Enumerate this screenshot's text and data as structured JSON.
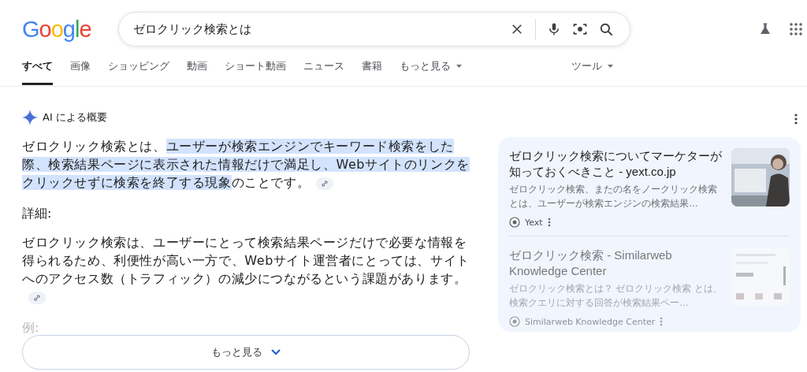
{
  "logo": "Google",
  "search": {
    "value": "ゼロクリック検索とは"
  },
  "tabs": [
    {
      "label": "すべて",
      "selected": true,
      "kind": "tab"
    },
    {
      "label": "画像",
      "selected": false,
      "kind": "tab"
    },
    {
      "label": "ショッピング",
      "selected": false,
      "kind": "tab"
    },
    {
      "label": "動画",
      "selected": false,
      "kind": "tab"
    },
    {
      "label": "ショート動画",
      "selected": false,
      "kind": "tab"
    },
    {
      "label": "ニュース",
      "selected": false,
      "kind": "tab"
    },
    {
      "label": "書籍",
      "selected": false,
      "kind": "tab"
    },
    {
      "label": "もっと見る",
      "selected": false,
      "kind": "menu"
    }
  ],
  "tools": "ツール",
  "ai_overview": {
    "title": "AI による概要",
    "summary": [
      {
        "text": "ゼロクリック検索とは、",
        "highlighted": false
      },
      {
        "text": "ユーザーが検索エンジンでキーワード検索をした際、検索結果ページに表示された情報だけで満足し、Webサイトのリンクをクリックせずに検索を終了する現象",
        "highlighted": true
      },
      {
        "text": "のことです。",
        "highlighted": false
      }
    ],
    "details_heading": "詳細:",
    "details": "ゼロクリック検索は、ユーザーにとって検索結果ページだけで必要な情報を得られるため、利便性が高い一方で、Webサイト運営者にとっては、サイトへのアクセス数（トラフィック）の減少につながるという課題があります。",
    "example_heading": "例:",
    "more_button": "もっと見る",
    "sources": [
      {
        "title": "ゼロクリック検索についてマーケターが知っておくべきこと - yext.co.jp",
        "snippet": "ゼロクリック検索、またの名をノークリック検索とは、ユーザーが検索エンジンの検索結果…",
        "site": "Yext",
        "faded": false
      },
      {
        "title": "ゼロクリック検索 - Similarweb Knowledge Center",
        "snippet": "ゼロクリック検索とは？ ゼロクリック検索 とは、検索クエリに対する回答が検索結果ペー…",
        "site": "Similarweb Knowledge Center",
        "faded": true
      }
    ]
  }
}
